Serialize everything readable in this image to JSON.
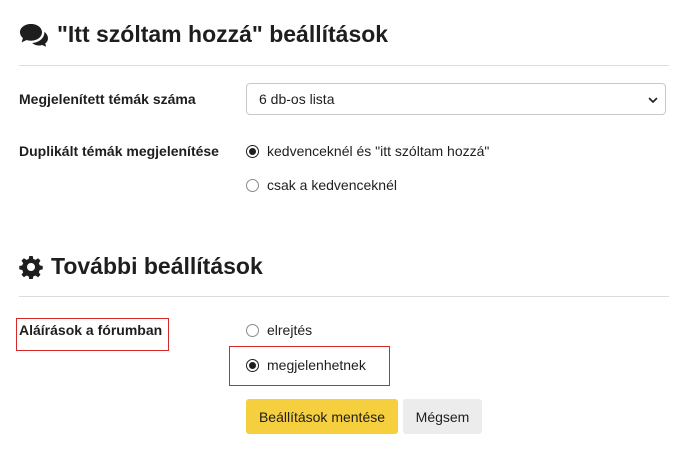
{
  "section1": {
    "title": "\"Itt szóltam hozzá\" beállítások",
    "icon": "comments-icon",
    "topics_count": {
      "label": "Megjelenített témák száma",
      "selected": "6 db-os lista"
    },
    "duplicate_topics": {
      "label": "Duplikált témák megjelenítése",
      "options": [
        {
          "label": "kedvenceknél és \"itt szóltam hozzá\"",
          "checked": true
        },
        {
          "label": "csak a kedvenceknél",
          "checked": false
        }
      ]
    }
  },
  "section2": {
    "title": "További beállítások",
    "icon": "gear-icon",
    "signatures": {
      "label": "Aláírások a fórumban",
      "options": [
        {
          "label": "elrejtés",
          "checked": false
        },
        {
          "label": "megjelenhetnek",
          "checked": true
        }
      ]
    }
  },
  "buttons": {
    "save_label": "Beállítások mentése",
    "cancel_label": "Mégsem"
  },
  "colors": {
    "accent": "#f6cf3f",
    "highlight": "#d62828",
    "cancel_bg": "#ececec"
  }
}
